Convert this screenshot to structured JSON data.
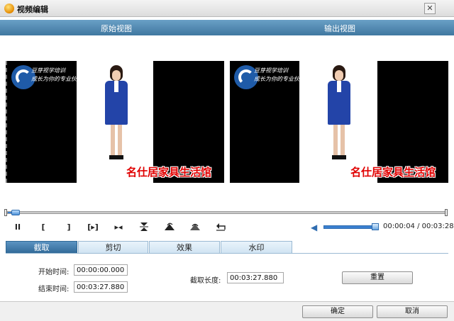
{
  "window": {
    "title": "视频编辑",
    "close_glyph": "✕"
  },
  "views": {
    "original_label": "原始视图",
    "output_label": "输出视图"
  },
  "video": {
    "caption": "名仕居家具生活馆",
    "logo_line1": "豆芽视学培训",
    "logo_line2": "成长为你的专业伙伴"
  },
  "playback": {
    "pause_glyph": "II",
    "mark_in_glyph": "[",
    "mark_out_glyph": "]",
    "play_selection_glyph": "[▸]",
    "step_glyph": "▸◂",
    "icons": [
      "pause-icon",
      "mark-in-icon",
      "mark-out-icon",
      "play-selection-icon",
      "step-icon",
      "split-icon",
      "rotate-icon",
      "flip-icon",
      "undo-icon"
    ],
    "current_time": "00:00:04",
    "total_time": "00:03:28",
    "time_separator": "/",
    "volume_level": 0.95,
    "progress_fraction": 0.02
  },
  "tabs": [
    "截取",
    "剪切",
    "效果",
    "水印"
  ],
  "trim": {
    "start_label": "开始时间:",
    "start_value": "00:00:00.000",
    "end_label": "结束时间:",
    "end_value": "00:03:27.880",
    "length_label": "截取长度:",
    "length_value": "00:03:27.880",
    "reset_label": "重置"
  },
  "footer": {
    "ok_label": "确定",
    "cancel_label": "取消"
  },
  "colors": {
    "accent": "#3f77a0",
    "caption_red": "#e00000",
    "tab_active": "#2f6896"
  }
}
